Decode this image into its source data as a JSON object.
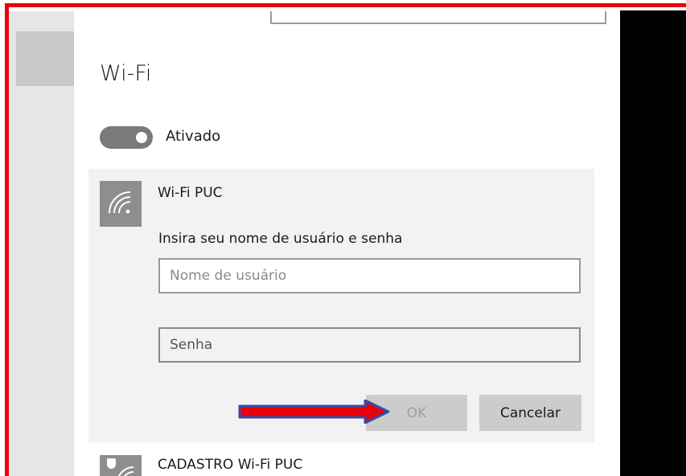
{
  "settings": {
    "title": "Wi-Fi",
    "toggle_label": "Ativado",
    "toggle_state": "on"
  },
  "network": {
    "name": "Wi-Fi PUC",
    "prompt": "Insira seu nome de usuário e senha",
    "username_placeholder": "Nome de usuário",
    "password_placeholder": "Senha",
    "ok_label": "OK",
    "cancel_label": "Cancelar"
  },
  "other_networks": [
    {
      "name": "CADASTRO Wi-Fi PUC"
    }
  ],
  "colors": {
    "annotation_border": "#e8000b",
    "arrow_fill": "#e8000b",
    "arrow_outline": "#2f4fa8",
    "toggle_on": "#7a7a7a"
  },
  "icons": {
    "network": "wifi-icon",
    "secured_network": "shield-wifi-icon",
    "annotation": "arrow-right-icon"
  }
}
